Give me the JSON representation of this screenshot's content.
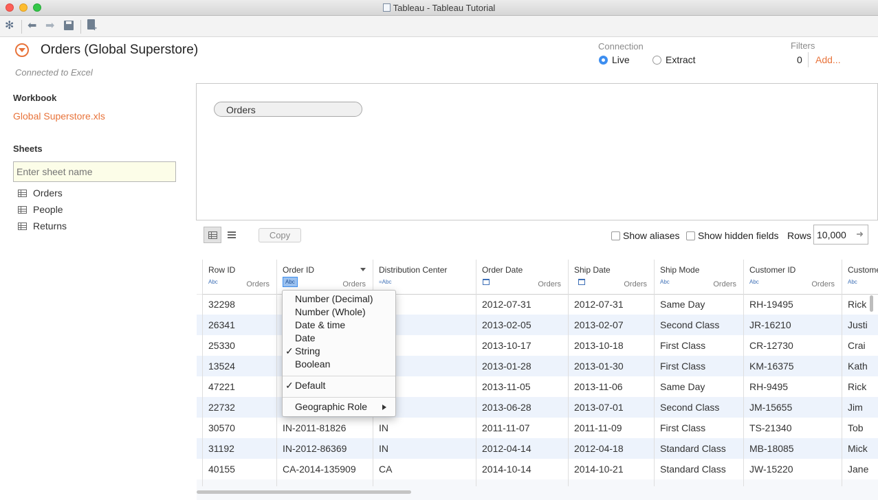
{
  "window": {
    "title": "Tableau - Tableau Tutorial"
  },
  "header": {
    "datasource_title": "Orders (Global Superstore)",
    "connection_status": "Connected to Excel",
    "connection_label": "Connection",
    "live_label": "Live",
    "extract_label": "Extract",
    "connection_selected": "Live",
    "filters_label": "Filters",
    "filters_count": "0",
    "filters_add": "Add..."
  },
  "sidebar": {
    "workbook_heading": "Workbook",
    "workbook_file": "Global Superstore.xls",
    "sheets_heading": "Sheets",
    "sheet_search_placeholder": "Enter sheet name",
    "sheets": [
      "Orders",
      "People",
      "Returns"
    ]
  },
  "canvas": {
    "table_pill": "Orders"
  },
  "grid_toolbar": {
    "copy_label": "Copy",
    "show_aliases_label": "Show aliases",
    "show_hidden_fields_label": "Show hidden fields",
    "rows_label": "Rows",
    "rows_value": "10,000"
  },
  "table": {
    "columns": [
      {
        "name": "Row ID",
        "type": "Abc",
        "source": "Orders"
      },
      {
        "name": "Order ID",
        "type": "Abc",
        "source": "Orders"
      },
      {
        "name": "Distribution Center",
        "type": "=Abc",
        "source": ""
      },
      {
        "name": "Order Date",
        "type": "date",
        "source": "Orders"
      },
      {
        "name": "Ship Date",
        "type": "date",
        "source": "Orders"
      },
      {
        "name": "Ship Mode",
        "type": "Abc",
        "source": "Orders"
      },
      {
        "name": "Customer ID",
        "type": "Abc",
        "source": "Orders"
      },
      {
        "name": "Custome",
        "type": "Abc",
        "source": ""
      }
    ],
    "rows": [
      [
        "32298",
        "",
        "",
        "2012-07-31",
        "2012-07-31",
        "Same Day",
        "RH-19495",
        "Rick"
      ],
      [
        "26341",
        "",
        "",
        "2013-02-05",
        "2013-02-07",
        "Second Class",
        "JR-16210",
        "Justi"
      ],
      [
        "25330",
        "",
        "",
        "2013-10-17",
        "2013-10-18",
        "First Class",
        "CR-12730",
        "Crai"
      ],
      [
        "13524",
        "",
        "",
        "2013-01-28",
        "2013-01-30",
        "First Class",
        "KM-16375",
        "Kath"
      ],
      [
        "47221",
        "",
        "",
        "2013-11-05",
        "2013-11-06",
        "Same Day",
        "RH-9495",
        "Rick"
      ],
      [
        "22732",
        "",
        "",
        "2013-06-28",
        "2013-07-01",
        "Second Class",
        "JM-15655",
        "Jim"
      ],
      [
        "30570",
        "IN-2011-81826",
        "IN",
        "2011-11-07",
        "2011-11-09",
        "First Class",
        "TS-21340",
        "Tob"
      ],
      [
        "31192",
        "IN-2012-86369",
        "IN",
        "2012-04-14",
        "2012-04-18",
        "Standard Class",
        "MB-18085",
        "Mick"
      ],
      [
        "40155",
        "CA-2014-135909",
        "CA",
        "2014-10-14",
        "2014-10-21",
        "Standard Class",
        "JW-15220",
        "Jane"
      ]
    ]
  },
  "type_menu": {
    "items": [
      "Number (Decimal)",
      "Number (Whole)",
      "Date & time",
      "Date",
      "String",
      "Boolean"
    ],
    "checked_item": "String",
    "default_label": "Default",
    "geographic_role_label": "Geographic Role"
  },
  "colors": {
    "accent": "#e8733a",
    "selection_blue": "#3d8ef0",
    "row_stripe": "#edf3fc"
  }
}
